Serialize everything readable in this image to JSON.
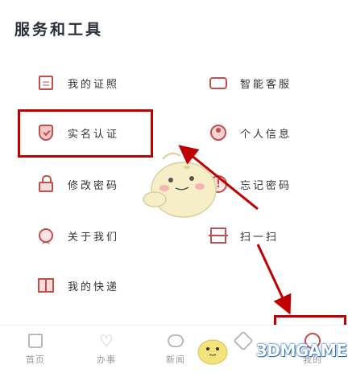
{
  "section_title": "服务和工具",
  "tools": [
    {
      "label": "我的证照",
      "icon": "certificate-icon"
    },
    {
      "label": "智能客服",
      "icon": "chat-bubble-icon"
    },
    {
      "label": "实名认证",
      "icon": "shield-check-icon"
    },
    {
      "label": "个人信息",
      "icon": "person-icon"
    },
    {
      "label": "修改密码",
      "icon": "lock-icon"
    },
    {
      "label": "忘记密码",
      "icon": "exclamation-icon"
    },
    {
      "label": "关于我们",
      "icon": "user-circle-icon"
    },
    {
      "label": "扫一扫",
      "icon": "scan-icon"
    },
    {
      "label": "我的快递",
      "icon": "package-icon"
    }
  ],
  "nav": [
    {
      "label": "首页",
      "icon": "home-icon"
    },
    {
      "label": "办事",
      "icon": "heart-icon"
    },
    {
      "label": "新闻",
      "icon": "message-icon"
    },
    {
      "label": "",
      "icon": "bell-icon"
    },
    {
      "label": "我的",
      "icon": "user-icon",
      "active": true
    }
  ],
  "watermark": "3DMGAME",
  "colors": {
    "accent": "#c0504d",
    "annotation": "#c00000",
    "text": "#333333",
    "title": "#2a2f3a"
  }
}
